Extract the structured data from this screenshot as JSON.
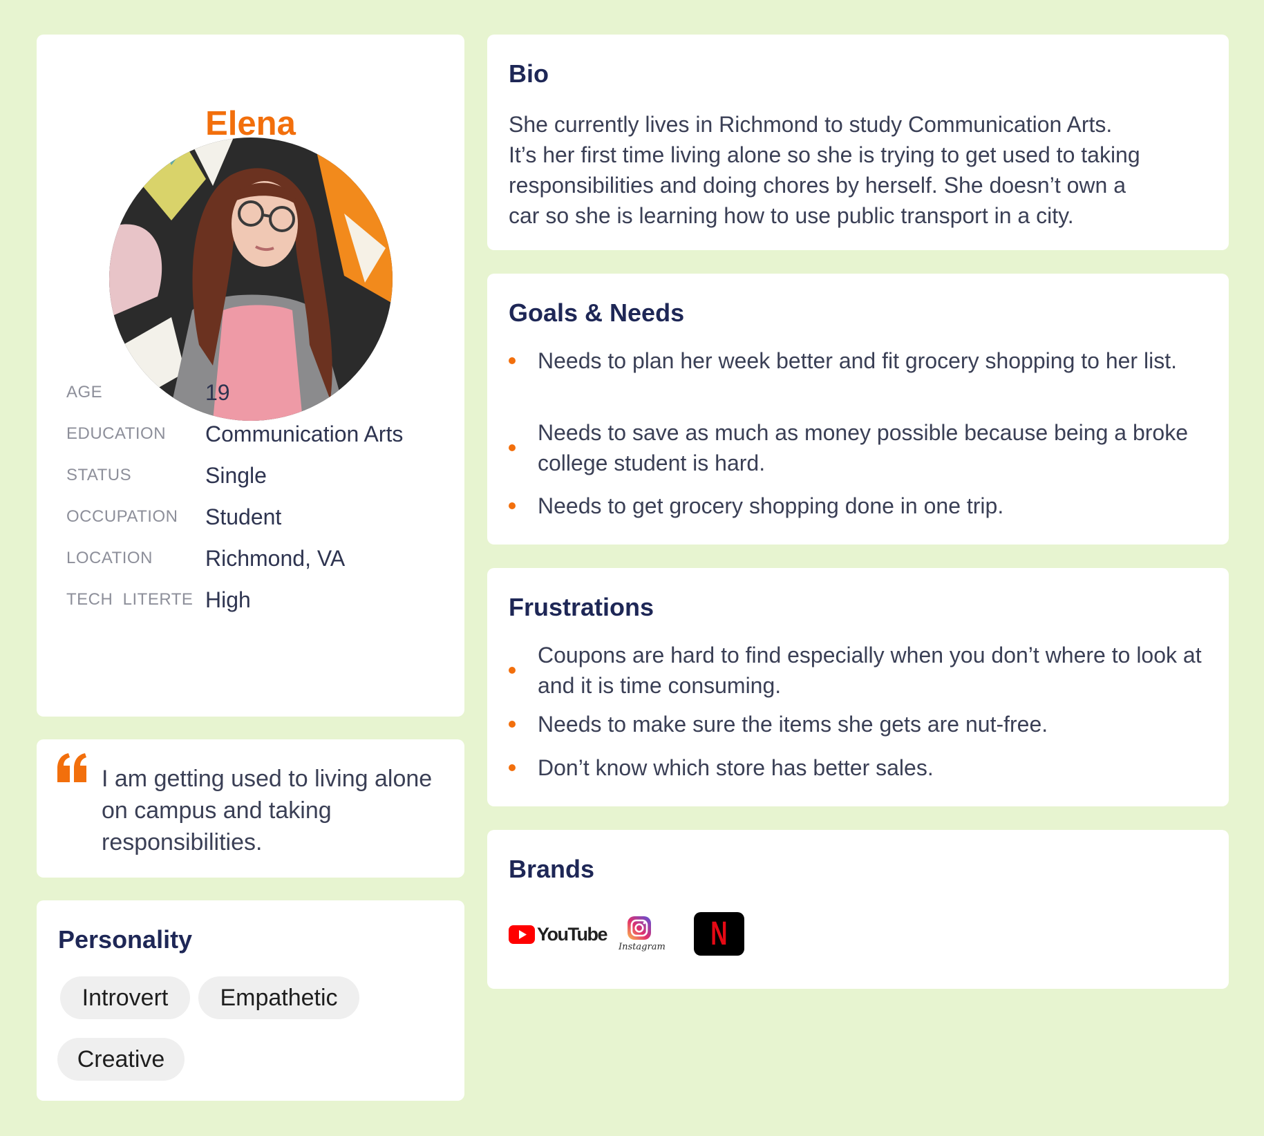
{
  "profile": {
    "name": "Elena",
    "info": [
      {
        "label": "AGE",
        "value": "19"
      },
      {
        "label": "EDUCATION",
        "value": "Communication Arts"
      },
      {
        "label": "STATUS",
        "value": "Single"
      },
      {
        "label": "OCCUPATION",
        "value": "Student"
      },
      {
        "label": "LOCATION",
        "value": "Richmond, VA"
      },
      {
        "label": "TECH  LITERTE",
        "value": "High"
      }
    ]
  },
  "quote": {
    "text": "I am getting used to living alone on campus and taking responsibilities."
  },
  "personality": {
    "title": "Personality",
    "traits": [
      "Introvert",
      "Empathetic",
      "Creative"
    ]
  },
  "bio": {
    "title": "Bio",
    "lines": [
      "She currently lives in Richmond to study Communication Arts.",
      "It’s her first time living alone so she is trying to get used to taking",
      "responsibilities and doing chores by herself. She doesn’t own a",
      "car so she is learning how to use public transport in a city."
    ]
  },
  "goals": {
    "title": "Goals & Needs",
    "items": [
      "Needs to plan her week better and fit grocery shopping to her list.",
      "Needs to save as much as money possible because being a broke college student is hard.",
      "Needs to get grocery shopping done in one trip."
    ]
  },
  "frustrations": {
    "title": "Frustrations",
    "items": [
      "Coupons are hard to find especially when you don’t where to look at and it is time consuming.",
      "Needs to make sure the items she gets are nut-free.",
      "Don’t know which store has better sales."
    ]
  },
  "brands": {
    "title": "Brands",
    "logos": [
      {
        "name": "YouTube",
        "icon": "youtube-logo"
      },
      {
        "name": "Instagram",
        "icon": "instagram-logo"
      },
      {
        "name": "N",
        "icon": "netflix-logo"
      }
    ]
  },
  "colors": {
    "background": "#e7f4d0",
    "accent": "#f26f0c",
    "heading": "#1e2756",
    "text": "#3a3f55"
  }
}
